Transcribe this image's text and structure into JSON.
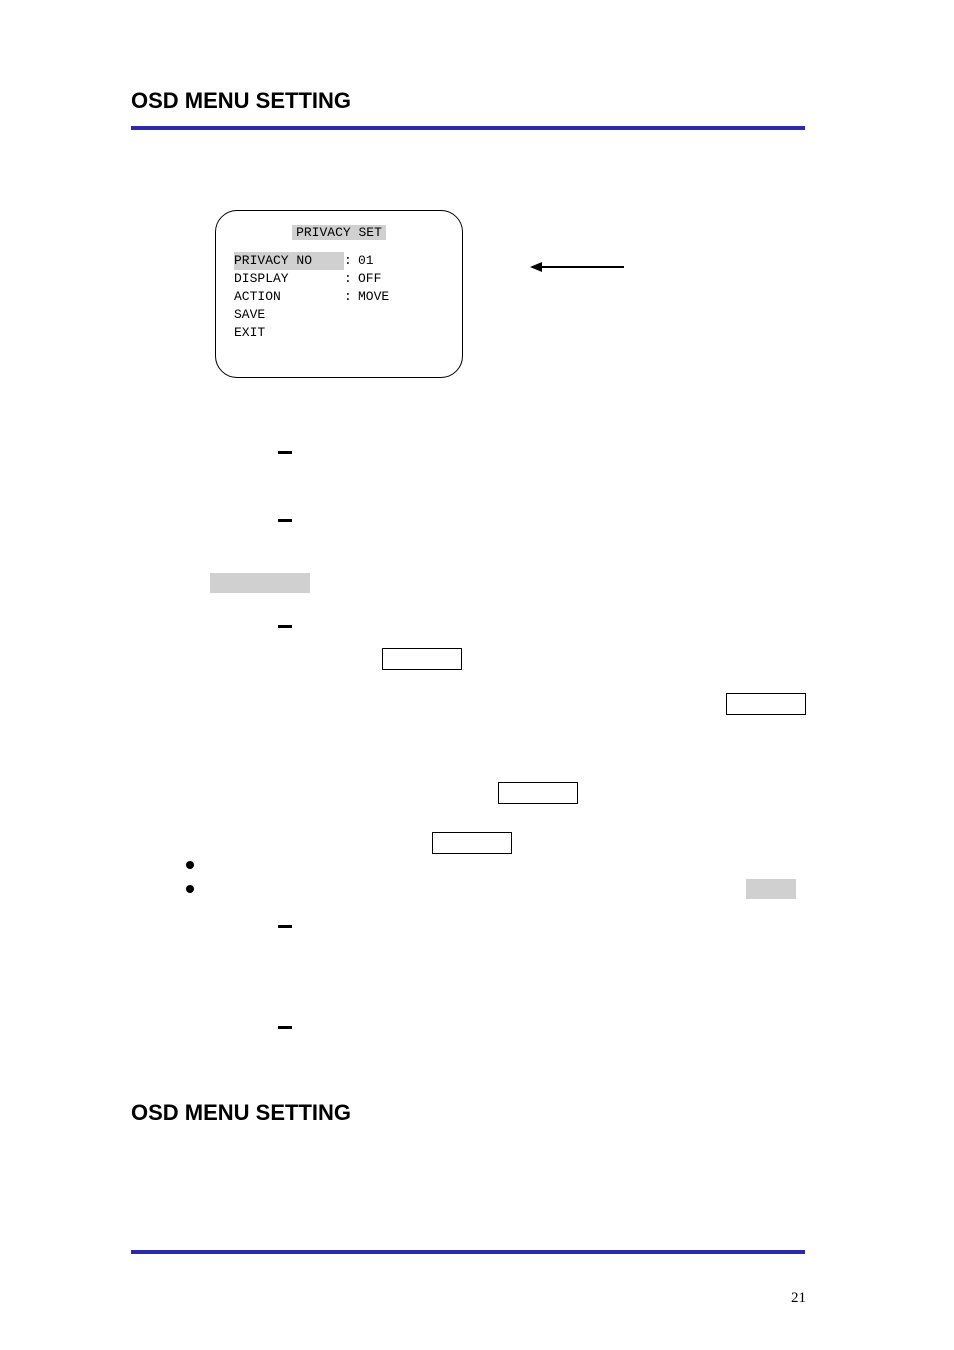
{
  "title_top": "OSD MENU SETTING",
  "title_bottom": "OSD MENU SETTING",
  "menu": {
    "title": "PRIVACY SET",
    "rows": [
      {
        "label": "PRIVACY NO",
        "value": "01"
      },
      {
        "label": "DISPLAY",
        "value": "OFF"
      },
      {
        "label": "ACTION",
        "value": "MOVE"
      },
      {
        "label": "SAVE",
        "value": ""
      },
      {
        "label": "EXIT",
        "value": ""
      }
    ]
  },
  "page_number": "21"
}
